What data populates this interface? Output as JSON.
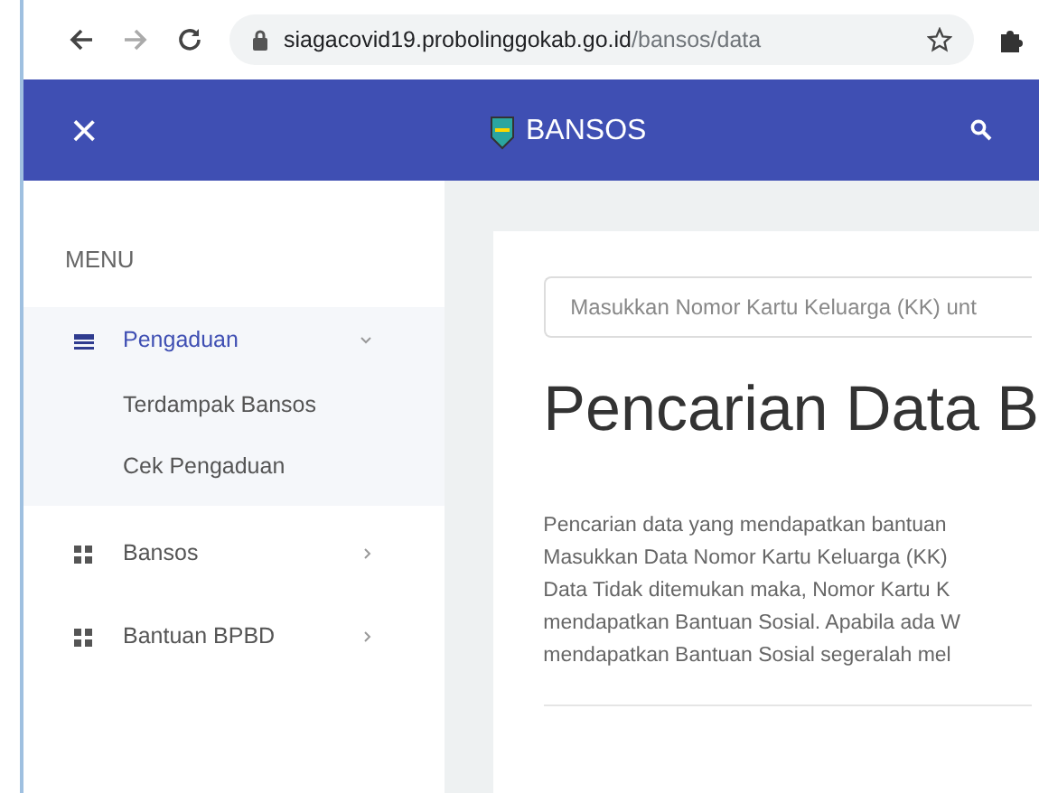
{
  "browser": {
    "url_host": "siagacovid19.probolinggokab.go.id",
    "url_path": "/bansos/data"
  },
  "header": {
    "close": "×",
    "title": "BANSOS"
  },
  "sidebar": {
    "heading": "MENU",
    "items": [
      {
        "label": "Pengaduan",
        "kind": "table",
        "expanded": true,
        "selected": true,
        "children": [
          {
            "label": "Terdampak Bansos"
          },
          {
            "label": "Cek Pengaduan"
          }
        ]
      },
      {
        "label": "Bansos",
        "kind": "grid",
        "expanded": false,
        "selected": false
      },
      {
        "label": "Bantuan BPBD",
        "kind": "grid",
        "expanded": false,
        "selected": false
      }
    ]
  },
  "main": {
    "search": {
      "placeholder": "Masukkan Nomor Kartu Keluarga (KK) unt"
    },
    "heading": "Pencarian Data B",
    "paragraph": [
      "Pencarian data yang mendapatkan bantuan",
      "Masukkan Data Nomor Kartu Keluarga (KK)",
      "Data Tidak ditemukan maka, Nomor Kartu K",
      "mendapatkan Bantuan Sosial. Apabila ada W",
      "mendapatkan Bantuan Sosial segeralah mel"
    ]
  }
}
